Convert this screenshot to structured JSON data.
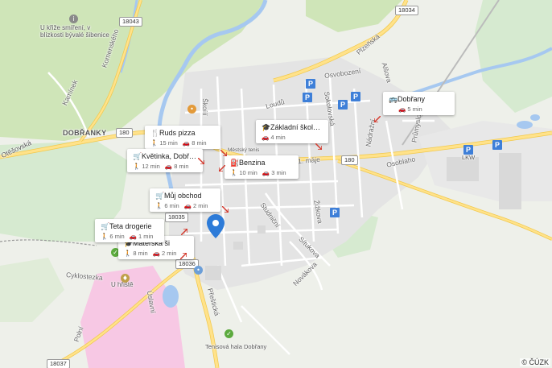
{
  "map": {
    "attribution": "© ČÚZK",
    "colors": {
      "water": "#a6c8f0",
      "forest": "#cfe5b8",
      "urban": "#e6e6e6",
      "road_major": "#ffe28a",
      "road_minor": "#ffffff",
      "pink_area": "#f7c8e4",
      "park_badge": "#3e7fd8",
      "pin": "#2d7bd8"
    },
    "route_shields": [
      "18043",
      "18034",
      "180",
      "180",
      "18035",
      "18036",
      "18037"
    ],
    "street_labels": [
      "Komenského",
      "Kamínek",
      "Škoííí",
      "Loudů",
      "Osvobození",
      "Plzeňská",
      "Alšova",
      "Sokolovská",
      "Nádražní",
      "Průmyslová",
      "Osoblaho",
      "1. máje",
      "Jiráskova",
      "Žižkova",
      "Studniční",
      "Sítukova",
      "Novákova",
      "Přeštická",
      "Úslavní",
      "Polní",
      "Cyklostezka",
      "Húzeká",
      "Hutnická"
    ],
    "place_labels": {
      "town": "DOBŘANKY",
      "cross": "U křiže smíření, v blízkosti bývalé šibenice",
      "playground": "U hřiště",
      "tennis_hall": "Tenisová hala Dobřany",
      "tennis": "Městský tenis",
      "lkw": "LKW",
      "village": "Otěšovská"
    },
    "parking_label": "P",
    "pois": [
      {
        "name": "Ruds pizza",
        "icon": "restaurant-icon",
        "glyph": "🍴",
        "walk": "15 min",
        "drive": "8 min"
      },
      {
        "name": "Květinka, Dobřany",
        "icon": "shop-icon",
        "glyph": "🛒",
        "walk": "12 min",
        "drive": "8 min"
      },
      {
        "name": "Benzina",
        "icon": "fuel-icon",
        "glyph": "⛽",
        "walk": "10 min",
        "drive": "3 min"
      },
      {
        "name": "Můj obchod",
        "icon": "shop-icon",
        "glyph": "🛒",
        "walk": "6 min",
        "drive": "2 min"
      },
      {
        "name": "Teta drogerie",
        "icon": "shop-icon",
        "glyph": "🛒",
        "walk": "6 min",
        "drive": "1 min"
      },
      {
        "name": "Mateřská ši",
        "icon": "school-icon",
        "glyph": "🎓",
        "walk": "8 min",
        "drive": "2 min"
      },
      {
        "name": "Základní škola Do...",
        "icon": "school-icon",
        "glyph": "🎓",
        "walk": "",
        "drive": "4 min"
      },
      {
        "name": "Dobřany",
        "icon": "bus-icon",
        "glyph": "🚌",
        "walk": "",
        "drive": "5 min"
      }
    ]
  }
}
